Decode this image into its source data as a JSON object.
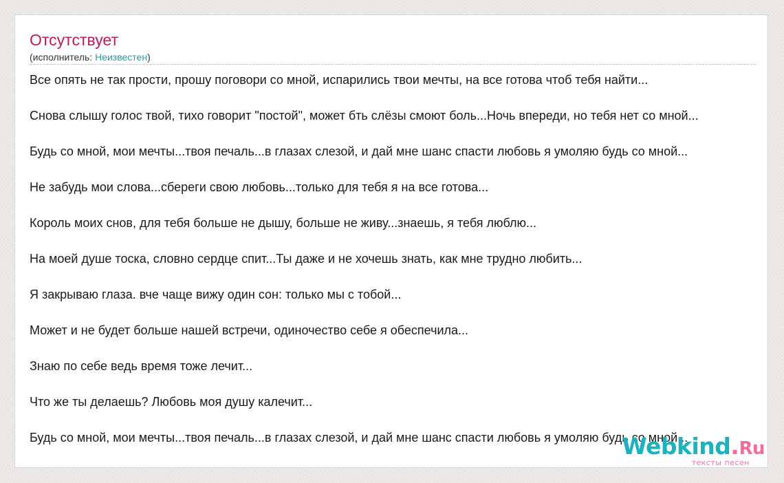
{
  "song": {
    "title": "Отсутствует",
    "artist_prefix": "(исполнитель: ",
    "artist_name": "Неизвестен",
    "artist_suffix": ")"
  },
  "lyrics": [
    "Все опять не так прости, прошу поговори со мной, испарились твои мечты, на все готова чтоб тебя найти...",
    "Снова слышу голос твой, тихо говорит \"постой\", может бть слёзы смоют боль...Ночь впереди, но тебя нет со мной...",
    "Будь со мной, мои мечты...твоя печаль...в глазах слезой, и дай мне шанс спасти любовь я умоляю будь со мной...",
    "Не забудь мои слова...сбереги свою любовь...только для тебя я на все готова...",
    "Король моих снов, для тебя больше не дышу, больше не живу...знаешь, я тебя люблю...",
    "На моей душе тоска, словно сердце спит...Ты даже и не хочешь знать, как мне трудно любить...",
    "Я закрываю глаза. вче чаще вижу один сон: только мы с тобой...",
    "Может и не будет больше нашей встречи, одиночество себе я обеспечила...",
    "Знаю по себе ведь время тоже лечит...",
    "Что же ты делаешь? Любовь моя душу калечит...",
    "Будь со мной, мои мечты...твоя печаль...в глазах слезой, и дай мне шанс спасти любовь я умоляю будь со мной..."
  ],
  "watermark": {
    "brand_main": "Webkind",
    "brand_sep": ".",
    "brand_tld": "Ru",
    "tagline": "тексты песен"
  },
  "colors": {
    "title": "#c2185b",
    "artist_link": "#2e9aa6",
    "watermark_primary": "#1cb2bd",
    "watermark_accent": "#f26d9c"
  }
}
